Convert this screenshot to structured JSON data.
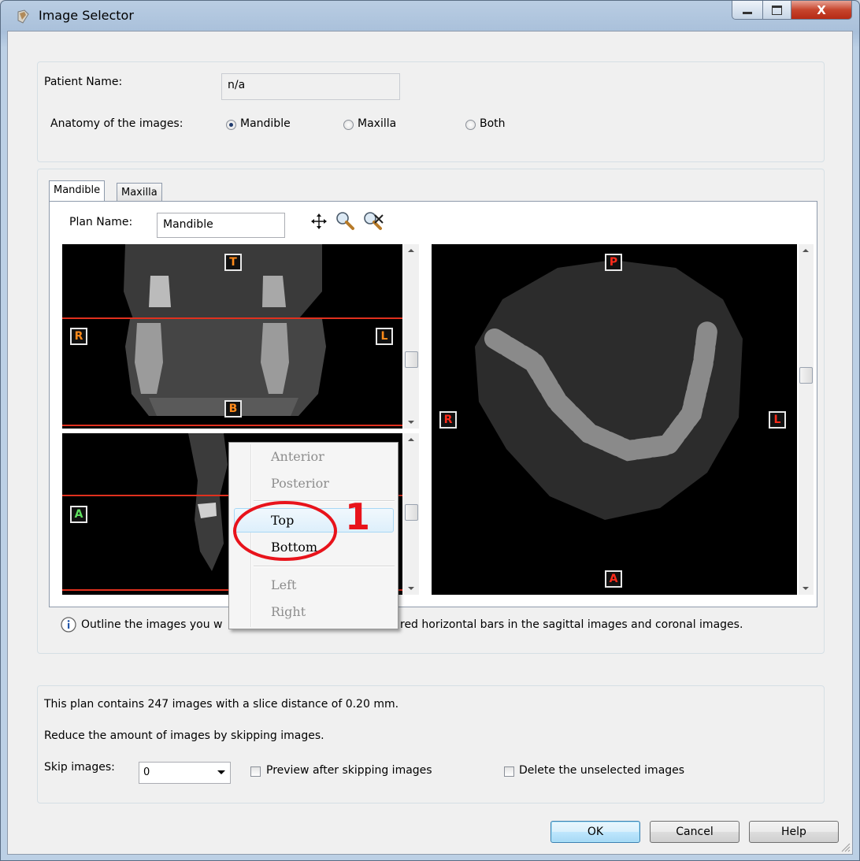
{
  "window": {
    "title": "Image Selector",
    "close_label": "X"
  },
  "patient": {
    "name_label": "Patient Name:",
    "name_value": "n/a",
    "anatomy_label": "Anatomy of the images:",
    "options": [
      "Mandible",
      "Maxilla",
      "Both"
    ],
    "selected": "Mandible"
  },
  "tabs": [
    {
      "label": "Mandible",
      "active": true
    },
    {
      "label": "Maxilla",
      "active": false
    }
  ],
  "plan": {
    "name_label": "Plan Name:",
    "name_value": "Mandible"
  },
  "tool_icons": [
    "move-icon",
    "zoom-icon",
    "zoom-reset-icon"
  ],
  "viewers": {
    "coronal": {
      "markers": [
        "T",
        "R",
        "L",
        "B"
      ]
    },
    "sagittal": {
      "markers": [
        "A"
      ]
    },
    "axial": {
      "markers": [
        "P",
        "R",
        "L",
        "A"
      ]
    }
  },
  "context_menu": {
    "items": [
      {
        "label": "Anterior",
        "enabled": false
      },
      {
        "label": "Posterior",
        "enabled": false
      },
      {
        "label": "Top",
        "enabled": true,
        "highlighted": true
      },
      {
        "label": "Bottom",
        "enabled": true
      },
      {
        "label": "Left",
        "enabled": false
      },
      {
        "label": "Right",
        "enabled": false
      }
    ]
  },
  "annotation": {
    "number": "1",
    "color": "#e8131b"
  },
  "hint": {
    "left": "Outline the images you w",
    "right": "red horizontal bars in the sagittal images and coronal images."
  },
  "summary": {
    "line1": "This plan contains 247 images with a slice distance of 0.20 mm.",
    "line2": "Reduce the amount of images by skipping images.",
    "skip_label": "Skip images:",
    "skip_value": "0",
    "preview_label": "Preview after skipping images",
    "delete_label": "Delete the unselected images"
  },
  "buttons": {
    "ok": "OK",
    "cancel": "Cancel",
    "help": "Help"
  }
}
